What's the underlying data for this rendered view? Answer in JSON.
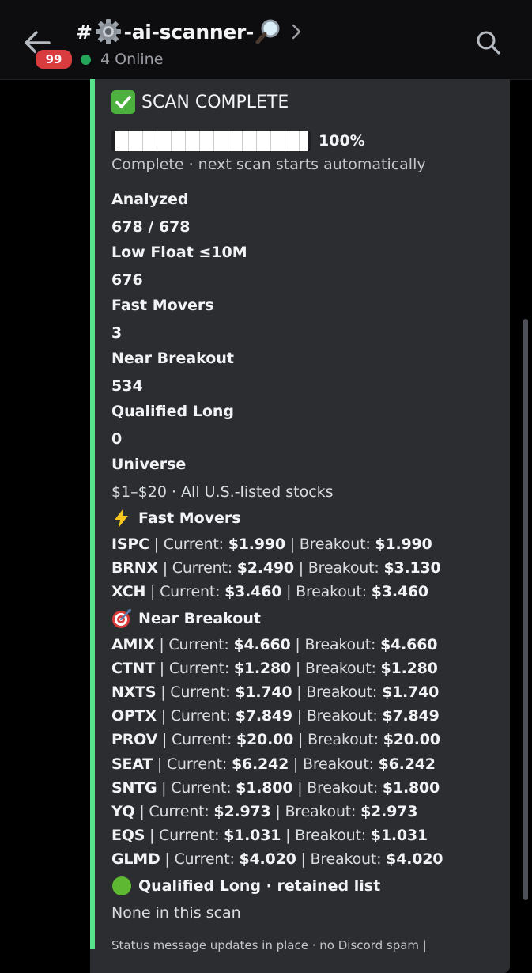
{
  "header": {
    "unread_count": "99",
    "channel_prefix": "#",
    "channel_name": "-ai-scanner-",
    "channel_icons": [
      "gear-icon",
      "magnifier-icon"
    ],
    "online_count": "4 Online",
    "online_color": "#23a55a"
  },
  "embed": {
    "accent_color": "#57e389",
    "title": "SCAN COMPLETE",
    "progress": {
      "fraction": 1.0,
      "percent_label": "100%"
    },
    "status": "Complete · next scan starts automatically",
    "fields": [
      {
        "name": "Analyzed",
        "value": "678 / 678"
      },
      {
        "name": "Low Float ≤10M",
        "value": "676"
      },
      {
        "name": "Fast Movers",
        "value": "3"
      },
      {
        "name": "Near Breakout",
        "value": "534"
      },
      {
        "name": "Qualified Long",
        "value": "0"
      },
      {
        "name": "Universe",
        "value": "$1–$20 · All U.S.-listed stocks"
      }
    ],
    "fast_movers": {
      "title": "Fast Movers",
      "icon": "lightning-icon",
      "rows": [
        {
          "ticker": "ISPC",
          "current": "$1.990",
          "breakout": "$1.990"
        },
        {
          "ticker": "BRNX",
          "current": "$2.490",
          "breakout": "$3.130"
        },
        {
          "ticker": "XCH",
          "current": "$3.460",
          "breakout": "$3.460"
        }
      ]
    },
    "near_breakout": {
      "title": "Near Breakout",
      "icon": "target-icon",
      "rows": [
        {
          "ticker": "AMIX",
          "current": "$4.660",
          "breakout": "$4.660"
        },
        {
          "ticker": "CTNT",
          "current": "$1.280",
          "breakout": "$1.280"
        },
        {
          "ticker": "NXTS",
          "current": "$1.740",
          "breakout": "$1.740"
        },
        {
          "ticker": "OPTX",
          "current": "$7.849",
          "breakout": "$7.849"
        },
        {
          "ticker": "PROV",
          "current": "$20.00",
          "breakout": "$20.00"
        },
        {
          "ticker": "SEAT",
          "current": "$6.242",
          "breakout": "$6.242"
        },
        {
          "ticker": "SNTG",
          "current": "$1.800",
          "breakout": "$1.800"
        },
        {
          "ticker": "YQ",
          "current": "$2.973",
          "breakout": "$2.973"
        },
        {
          "ticker": "EQS",
          "current": "$1.031",
          "breakout": "$1.031"
        },
        {
          "ticker": "GLMD",
          "current": "$4.020",
          "breakout": "$4.020"
        }
      ]
    },
    "row_labels": {
      "sep": " | ",
      "current": "Current: ",
      "breakout": "Breakout: "
    },
    "qualified_long": {
      "title": "Qualified Long · retained list",
      "icon": "green-circle-icon",
      "value": "None in this scan"
    },
    "footer": "Status message updates in place · no Discord spam |"
  }
}
